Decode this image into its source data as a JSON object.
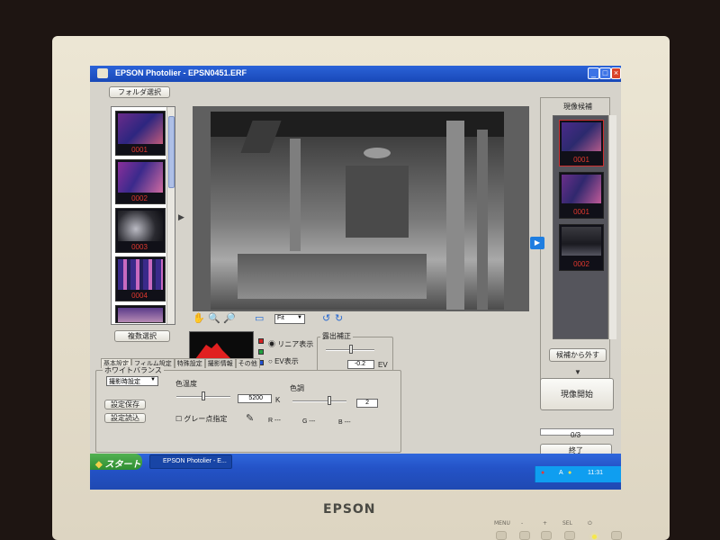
{
  "window": {
    "title": "EPSON Photolier - EPSN0451.ERF"
  },
  "left_panel": {
    "folder_button": "フォルダ選択",
    "thumbnails": [
      "0001",
      "0002",
      "0003",
      "0004"
    ],
    "batch_select_button": "複数選択"
  },
  "toolbar": {
    "zoom_value": "Fit"
  },
  "histogram": {
    "linear_label": "リニア表示",
    "ev_label": "EV表示"
  },
  "exposure": {
    "title": "露出補正",
    "value": "-0.2",
    "unit": "EV"
  },
  "tabs": [
    "基本設定",
    "フィルム設定",
    "特殊設定",
    "撮影情報",
    "その他"
  ],
  "white_balance": {
    "title": "ホワイトバランス",
    "mode": "撮影時設定",
    "color_temp_label": "色温度",
    "color_temp_value": "5200",
    "color_temp_unit": "K",
    "tint_label": "色調",
    "tint_value": "2",
    "save_button": "設定保存",
    "load_button": "設定読込",
    "gray_point_label": "グレー点指定",
    "r_label": "R ---",
    "g_label": "G ---",
    "b_label": "B ---"
  },
  "right_panel": {
    "title": "現像候補",
    "thumbnails": [
      "0001",
      "0001",
      "0002"
    ],
    "remove_button": "候補から外す",
    "develop_button": "現像開始",
    "progress_text": "0/3",
    "finish_button": "終了"
  },
  "taskbar": {
    "start_label": "スタート",
    "task_label": "EPSON Photolier - E...",
    "ime_label": "A",
    "clock": "11:31"
  },
  "monitor": {
    "brand": "EPSON",
    "buttons": [
      "MENU",
      "-",
      "+",
      "SEL",
      "⏻"
    ]
  }
}
